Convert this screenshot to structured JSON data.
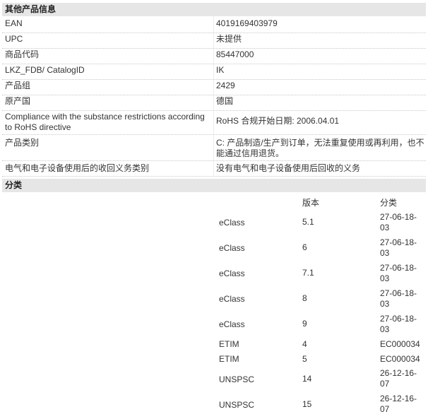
{
  "other_info": {
    "title": "其他产品信息",
    "rows": [
      {
        "label": "EAN",
        "value": "4019169403979"
      },
      {
        "label": "UPC",
        "value": "未提供"
      },
      {
        "label": "商品代码",
        "value": "85447000"
      },
      {
        "label": "LKZ_FDB/ CatalogID",
        "value": "IK"
      },
      {
        "label": "产品组",
        "value": "2429"
      },
      {
        "label": "原产国",
        "value": "德国"
      },
      {
        "label": "Compliance with the substance restrictions according to RoHS directive",
        "value": "RoHS 合规开始日期: 2006.04.01"
      },
      {
        "label": "产品类别",
        "value": "C: 产品制造/生产到订单，无法重复使用或再利用，也不能通过信用退货。"
      },
      {
        "label": "电气和电子设备使用后的收回义务类别",
        "value": "没有电气和电子设备使用后回收的义务"
      }
    ]
  },
  "classification": {
    "title": "分类",
    "headers": {
      "version": "版本",
      "classification": "分类"
    },
    "rows": [
      {
        "system": "eClass",
        "version": "5.1",
        "code": "27-06-18-03"
      },
      {
        "system": "eClass",
        "version": "6",
        "code": "27-06-18-03"
      },
      {
        "system": "eClass",
        "version": "7.1",
        "code": "27-06-18-03"
      },
      {
        "system": "eClass",
        "version": "8",
        "code": "27-06-18-03"
      },
      {
        "system": "eClass",
        "version": "9",
        "code": "27-06-18-03"
      },
      {
        "system": "ETIM",
        "version": "4",
        "code": "EC000034"
      },
      {
        "system": "ETIM",
        "version": "5",
        "code": "EC000034"
      },
      {
        "system": "UNSPSC",
        "version": "14",
        "code": "26-12-16-07"
      },
      {
        "system": "UNSPSC",
        "version": "15",
        "code": "26-12-16-07"
      }
    ]
  }
}
